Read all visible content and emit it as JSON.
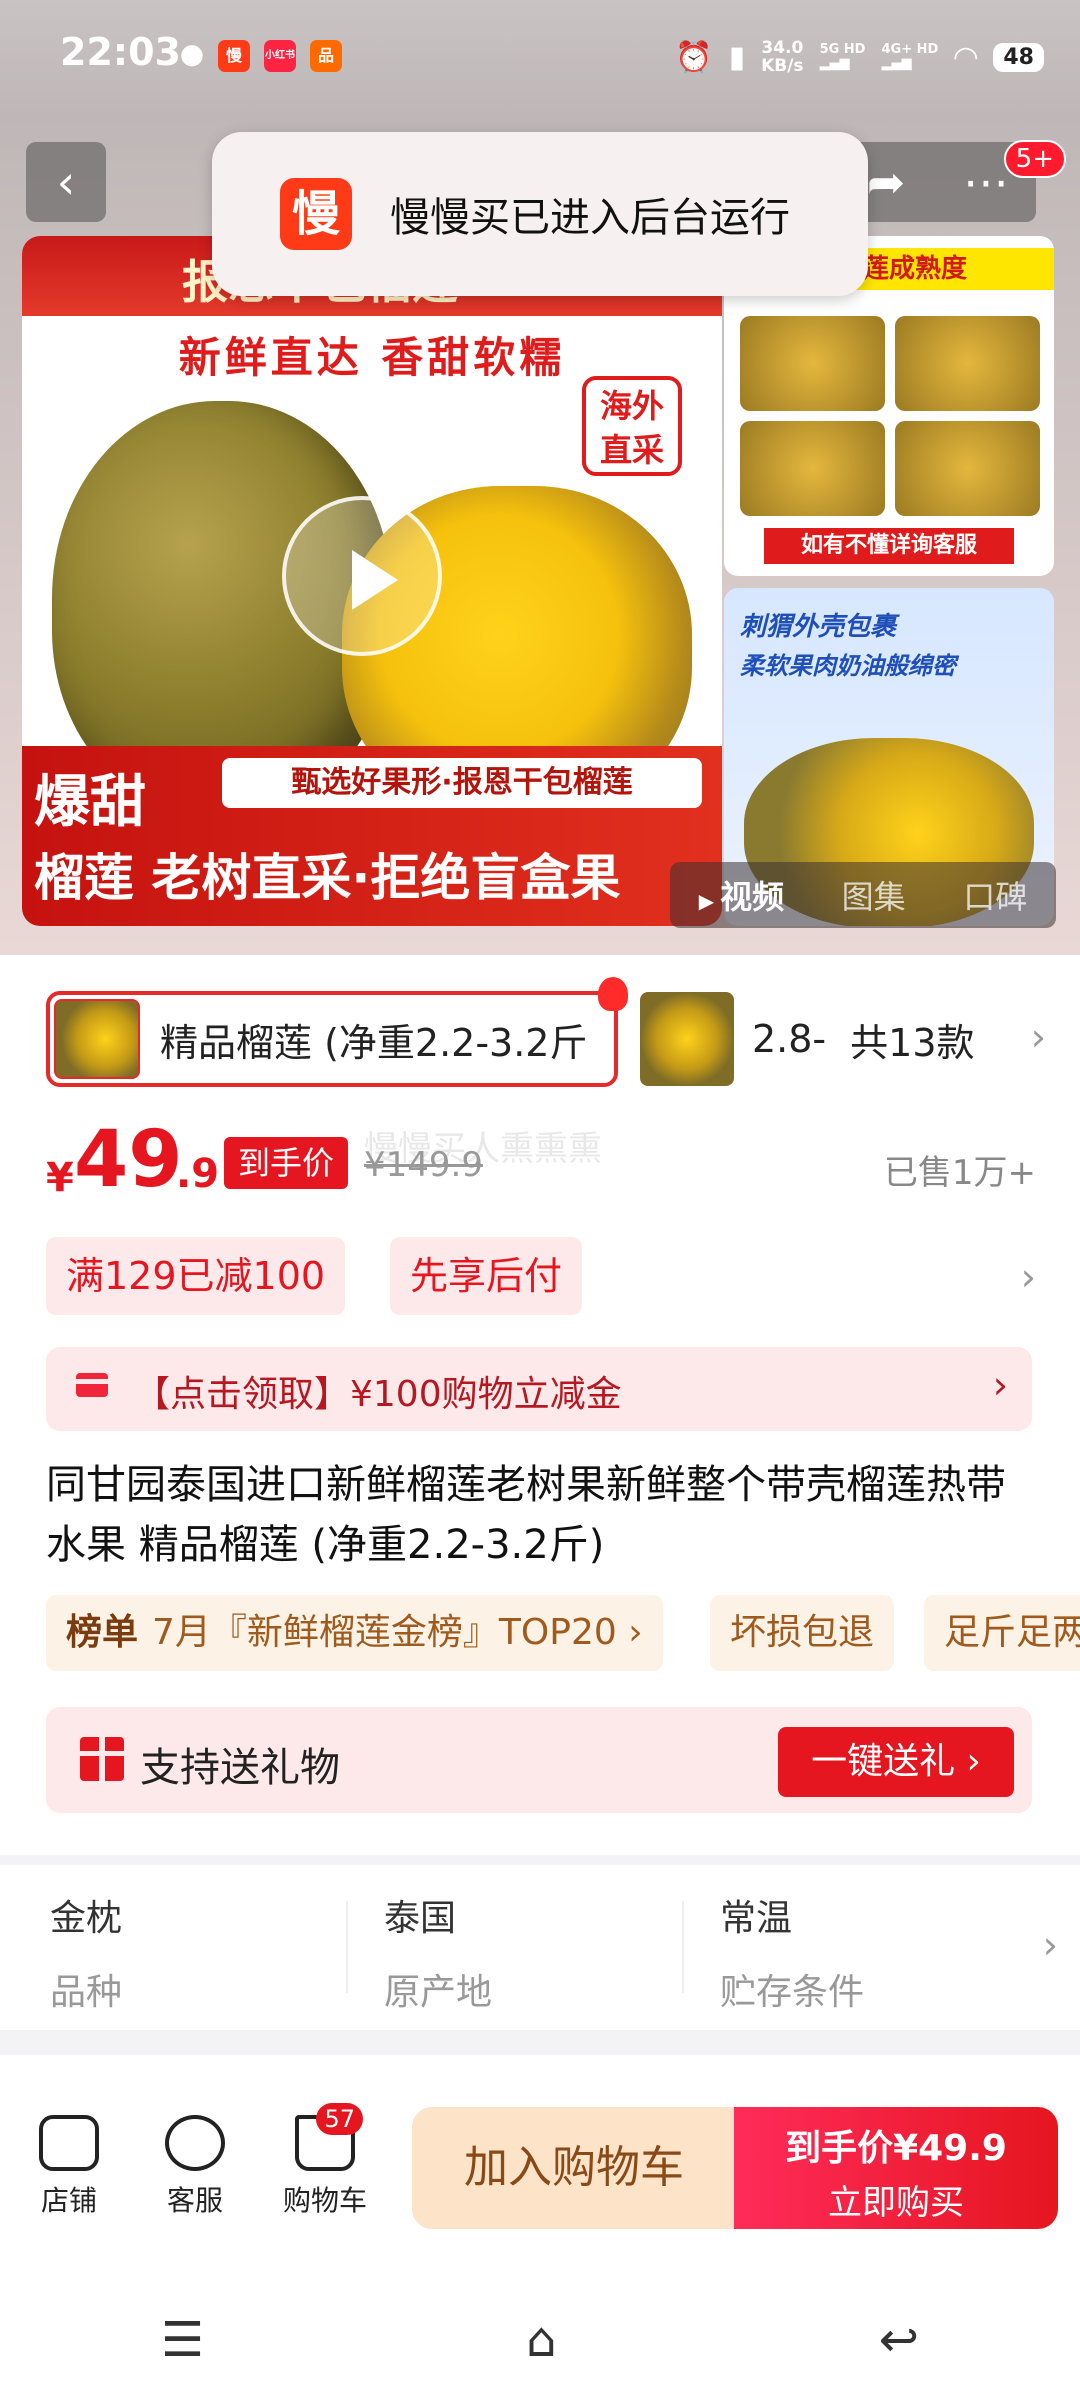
{
  "status_bar": {
    "time": "22:03",
    "net_speed_value": "34.0",
    "net_speed_unit": "KB/s",
    "net1": "5G HD",
    "net2": "4G+ HD",
    "battery": "48",
    "app_icons": [
      "wechat-icon",
      "manman-icon",
      "xiaohongshu-icon",
      "app-icon"
    ]
  },
  "header": {
    "back_icon": "chevron-left-icon",
    "share_icon": "share-icon",
    "more_icon": "more-dots-icon",
    "badge": "5+"
  },
  "toast": {
    "icon_text": "慢",
    "message": "慢慢买已进入后台运行"
  },
  "hero": {
    "poster_title": "报恩干包榴莲",
    "poster_sub": "新鲜直达  香甜软糯",
    "badge_overseas": "海外直采",
    "strip": "甄选好果形·报恩干包榴莲",
    "baotian": "爆甜",
    "bottom_text": "榴莲 老树直采·拒绝盲盒果",
    "right_top_head": "刺榴莲成熟度",
    "right_top_foot": "如有不懂详询客服",
    "right_bottom_title": "刺猬外壳包裹",
    "right_bottom_sub": "柔软果肉奶油般绵密",
    "media_tabs": [
      "视频",
      "图集",
      "口碑"
    ],
    "active_tab": 0
  },
  "sku": {
    "selected_name": "精品榴莲 (净重2.2-3.2斤",
    "alt_name": "2.8-",
    "count": "共13款"
  },
  "price": {
    "symbol": "¥",
    "integer": "49",
    "decimal": ".9",
    "tag": "到手价",
    "original": "¥149.9",
    "watermark": "慢慢买人熏熏熏",
    "sold": "已售1万+"
  },
  "promos": [
    "满129已减100",
    "先享后付"
  ],
  "coupon": {
    "text": "【点击领取】¥100购物立减金"
  },
  "title": "同甘园泰国进口新鲜榴莲老树果新鲜整个带壳榴莲热带水果 精品榴莲 (净重2.2-3.2斤)",
  "tags": {
    "rank_label": "榜单",
    "rank_text": "7月『新鲜榴莲金榜』TOP20 ›",
    "tag1": "坏损包退",
    "tag2": "足斤足两"
  },
  "gift": {
    "text": "支持送礼物",
    "button": "一键送礼 ›"
  },
  "attributes": [
    {
      "value": "金枕",
      "key": "品种"
    },
    {
      "value": "泰国",
      "key": "原产地"
    },
    {
      "value": "常温",
      "key": "贮存条件"
    }
  ],
  "bottom_bar": {
    "shop": "店铺",
    "service": "客服",
    "cart": "购物车",
    "cart_badge": "57",
    "add_cart": "加入购物车",
    "buy_price": "到手价¥49.9",
    "buy_label": "立即购买"
  },
  "system_nav": [
    "menu-icon",
    "home-icon",
    "back-icon"
  ],
  "colors": {
    "accent": "#e5161f",
    "coupon_bg": "#fde9ea",
    "tag_bg": "#fdf2e6",
    "cart_btn_bg": "#fde3c8"
  }
}
